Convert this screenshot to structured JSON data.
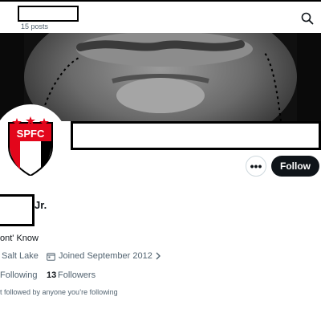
{
  "header": {
    "post_count": "15 posts",
    "search_icon": "search-icon"
  },
  "avatar": {
    "logo_text": "SPFC",
    "colors": {
      "red": "#e3061b",
      "black": "#000000",
      "gold": "#ffd700",
      "white": "#ffffff"
    }
  },
  "actions": {
    "more_label": "•••",
    "follow_label": "Follow"
  },
  "profile": {
    "name_suffix": "Jr.",
    "bio": "ont' Know",
    "location": "Salt Lake",
    "joined": "Joined September 2012",
    "following_label": "Following",
    "followers_count": "13",
    "followers_label": "Followers",
    "followed_by": "t followed by anyone you’re following"
  },
  "colors": {
    "text_primary": "#0f1419",
    "text_secondary": "#536471",
    "follow_bg": "#0f1419"
  }
}
